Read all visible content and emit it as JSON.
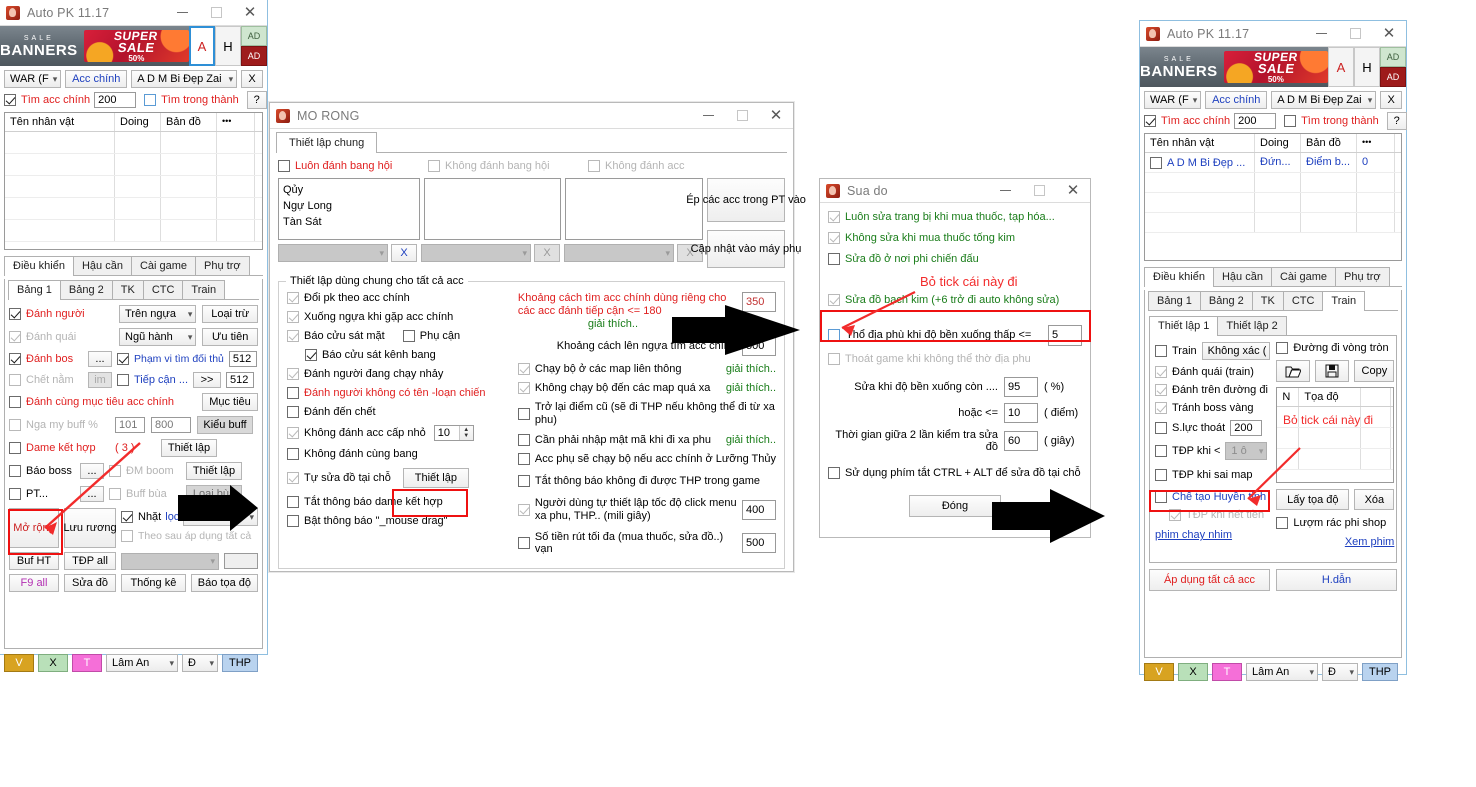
{
  "left_window": {
    "title": "Auto PK 11.17",
    "banner": {
      "sale": "SALE",
      "banners": "BANNERS",
      "super": "SUPER",
      "sale2": "SALE",
      "pct": "50%"
    },
    "a_button": "A",
    "h_button": "H",
    "ad_top": "AD",
    "ad_bottom": "AD",
    "row1": {
      "war_combo": "WAR (F",
      "acc_chinh": "Acc chính",
      "char_combo": "A D M Bi Đẹp Zai",
      "x_button": "X"
    },
    "row2": {
      "tim_acc_chinh": "Tìm acc chính",
      "tim_acc_value": "200",
      "tim_trong_thanh": "Tìm trong thành",
      "help_button": "?"
    },
    "grid_headers": [
      "Tên nhân vật",
      "Doing",
      "Bản đồ",
      "•••"
    ],
    "grid_rows": [],
    "main_tabs": [
      "Điều khiển",
      "Hậu cần",
      "Cài game",
      "Phụ trợ"
    ],
    "sub_tabs": [
      "Bảng 1",
      "Bảng 2",
      "TK",
      "CTC",
      "Train"
    ],
    "panel": {
      "danh_nguoi": "Đánh người",
      "tren_ngua": "Trên ngựa",
      "loai_tru": "Loại trừ",
      "danh_quai": "Đánh quái",
      "ngu_hanh": "Ngũ hành",
      "uu_tien": "Ưu tiên",
      "danh_bos": "Đánh bos",
      "dots": "...",
      "pham_vi": "Phạm vi tìm đối thủ",
      "pham_vi_value": "512",
      "chet_nam": "Chết nằm",
      "im": "im",
      "tiep_can": "Tiếp cận ...",
      "chevron": ">>",
      "tiep_can_value": "512",
      "danh_cung_muc_tieu": "Đánh cùng mục tiêu acc chính",
      "muc_tieu": "Mục tiêu",
      "nga_my_buff": "Nga my buff %",
      "nga_my_v1": "101",
      "nga_my_v2": "800",
      "kieu_buff": "Kiểu buff",
      "dame_ket_hop": "Dame kết hợp",
      "dame_count": "( 3 )",
      "thiet_lap1": "Thiết lập",
      "bao_boss": "Báo boss",
      "dm_boom": "ĐM boom",
      "thiet_lap2": "Thiết lập",
      "pt": "PT...",
      "buff_bua": "Buff bùa",
      "loai_bua": "Loại bùa",
      "mo_rong": "Mở rộng",
      "luu_ruong": "Lưu rương",
      "nhat": "Nhặt",
      "loc": "lọc",
      "tien_v": "Tiền v",
      "theo_sau": "Theo sau áp dụng tất cả",
      "buf_ht": "Buf HT",
      "tdp_all": "TĐP all",
      "f9_all": "F9 all",
      "sua_do": "Sửa đồ",
      "thong_ke": "Thống kê",
      "bao_toa_do": "Báo tọa độ"
    },
    "footer": {
      "v": "V",
      "x": "X",
      "t": "T",
      "lam_an": "Lâm An",
      "d": "Đ",
      "thp": "THP"
    }
  },
  "mo_rong_window": {
    "title": "MO RONG",
    "tab": "Thiết lập chung",
    "top_checks": [
      {
        "label": "Luôn đánh bang hội",
        "checked": false,
        "color": "red"
      },
      {
        "label": "Không đánh bang hội",
        "checked": false,
        "color": "grey"
      },
      {
        "label": "Không đánh acc",
        "checked": false,
        "color": "grey"
      }
    ],
    "list1": [
      "Qủy",
      "Ngự Long",
      "Tàn Sát"
    ],
    "list2": [],
    "list3": [],
    "ep_cac_acc": "Ép các acc trong PT vào",
    "cap_nhat": "Cập nhật vào máy phụ",
    "x1": "X",
    "x2": "X",
    "x3": "X",
    "group_title": "Thiết lập dùng chung cho tất cả acc",
    "left_checks": [
      {
        "label": "Đổi pk theo acc chính",
        "checked": true
      },
      {
        "label": "Xuống ngựa khi gặp acc chính",
        "checked": true
      },
      {
        "label": "Báo cửu sát mặt",
        "checked": true
      },
      {
        "label": "Phụ cận",
        "checked": false
      },
      {
        "label": "Báo cửu sát kênh bang",
        "checked": true,
        "indent": true
      },
      {
        "label": "Đánh người đang chạy nhảy",
        "checked": true
      },
      {
        "label": "Đánh người không có tên -loạn chiến",
        "checked": false,
        "color": "red"
      },
      {
        "label": "Đánh đến chết",
        "checked": false
      },
      {
        "label": "Không đánh acc cấp nhỏ",
        "checked": true,
        "spin": "10"
      },
      {
        "label": "Không đánh cùng bang",
        "checked": false
      },
      {
        "label": "Tự sửa đồ tại chỗ",
        "checked": true,
        "button": "Thiết lập"
      },
      {
        "label": "Tắt thông báo dame kết hợp",
        "checked": false
      },
      {
        "label": "Bật thông báo \"_mouse drag\"",
        "checked": false
      }
    ],
    "right_top_text": "Khoảng cách tìm acc chính dùng riêng cho các acc đánh tiếp cận <= 180",
    "giai_thich": "giải thích..",
    "right_top_value": "350",
    "right_second_text": "Khoảng cách lên ngựa tìm acc chính",
    "right_second_value": "500",
    "right_checks": [
      {
        "label": "Chạy bộ ở các map liên thông",
        "checked": true,
        "link": "giải thích.."
      },
      {
        "label": "Không chạy bộ đến các map quá xa",
        "checked": true,
        "link": "giải thích.."
      },
      {
        "label": "Trở lại điểm cũ (sẽ đi THP nếu không thể đi từ xa phu)",
        "checked": false
      },
      {
        "label": "Cần phải nhập mật mã khi đi xa phu",
        "checked": false,
        "link": "giải thích.."
      },
      {
        "label": "Acc phụ sẽ chạy bộ nếu acc chính ở Lưỡng Thủy",
        "checked": false
      },
      {
        "label": "Tắt thông báo không đi được THP trong game",
        "checked": false
      },
      {
        "label": "Người dùng tự thiết lập tốc độ click menu xa phu, THP.. (mili giây)",
        "checked": true,
        "value": "400"
      },
      {
        "label": "Số tiền rút tối đa (mua thuốc, sửa đồ..) vạn",
        "checked": false,
        "value": "500"
      }
    ]
  },
  "sua_do_window": {
    "title": "Sua do",
    "checks": [
      {
        "label": "Luôn sửa trang bị khi mua thuốc, tạp hóa...",
        "checked": true,
        "color": "green"
      },
      {
        "label": "Không sửa khi mua thuốc tống kim",
        "checked": true,
        "color": "green"
      },
      {
        "label": "Sửa đồ ở nơi phi chiến đấu",
        "checked": false,
        "color": "green"
      },
      {
        "label": "Sửa đồ bạch kim (+6 trở đi auto không sửa)",
        "checked": true,
        "color": "green"
      },
      {
        "label": "Thổ địa phù khi độ bền xuống thấp <=",
        "checked": false,
        "value": "5",
        "highlight": true
      },
      {
        "label": "Thoát game khi không thể thờ địa phu",
        "checked": false,
        "disabled": true
      }
    ],
    "annotation": "Bỏ tick cái này đi",
    "fields": [
      {
        "label": "Sửa khi độ bền xuống còn ....",
        "value": "95",
        "unit": "( %)"
      },
      {
        "label": "hoặc <=",
        "value": "10",
        "unit": "( điểm)"
      },
      {
        "label": "Thời gian giữa 2 lần kiểm tra sửa đồ",
        "value": "60",
        "unit": "( giây)"
      }
    ],
    "hotkey_check": {
      "label": "Sử dụng phím tắt CTRL + ALT để sửa đồ tại chỗ",
      "checked": false
    },
    "close_button": "Đóng"
  },
  "right_window": {
    "title": "Auto PK 11.17",
    "banner": {
      "sale": "SALE",
      "banners": "BANNERS",
      "super": "SUPER",
      "sale2": "SALE",
      "pct": "50%"
    },
    "a_button": "A",
    "h_button": "H",
    "ad_top": "AD",
    "ad_bottom": "AD",
    "row1": {
      "war_combo": "WAR (F",
      "acc_chinh": "Acc chính",
      "char_combo": "A D M Bi Đẹp Zai",
      "x_button": "X"
    },
    "row2": {
      "tim_acc_chinh": "Tìm acc chính",
      "tim_acc_value": "200",
      "tim_trong_thanh": "Tìm trong thành",
      "help_button": "?"
    },
    "grid_headers": [
      "Tên nhân vật",
      "Doing",
      "Bản đồ",
      "•••"
    ],
    "grid_rows": [
      {
        "name": "A D M Bi Đẹp ...",
        "doing": "Đứn...",
        "map": "Điểm b...",
        "num": "0"
      }
    ],
    "main_tabs": [
      "Điều khiển",
      "Hậu cần",
      "Cài game",
      "Phụ trợ"
    ],
    "sub_tabs": [
      "Bảng 1",
      "Bảng 2",
      "TK",
      "CTC",
      "Train"
    ],
    "train_tabs": [
      "Thiết lập 1",
      "Thiết lập 2"
    ],
    "train": {
      "train_check": "Train",
      "khong_xac": "Không xác (",
      "duong_di_vong_tron": "Đường đi vòng tròn",
      "open_icon": "folder-open-icon",
      "save_icon": "save-icon",
      "copy": "Copy",
      "grid_n": "N",
      "grid_toado": "Tọa độ",
      "annotation": "Bỏ tick cái này đi",
      "danh_quai": "Đánh quái (train)",
      "danh_tren_duong": "Đánh trên đường đi",
      "tranh_boss": "Tránh boss vàng",
      "s_luc_thoat": "S.lực thoát",
      "s_luc_value": "200",
      "tdp_khi": "TĐP khi <",
      "tdp_combo": "1 ô",
      "tdp_sai_map": "TĐP khi sai map",
      "che_tao": "Chế tạo Huyền tinh",
      "tdp_het_tien": "TĐP khi hết tiền",
      "phim_chay_nhim": "phim chay nhim",
      "lay_toa_do": "Lấy tọa độ",
      "xoa": "Xóa",
      "luom_rac": "Lượm rác phi shop",
      "xem_phim": "Xem phim",
      "ap_dung": "Áp dụng tất cả acc",
      "h_dan": "H.dẫn"
    },
    "footer": {
      "v": "V",
      "x": "X",
      "t": "T",
      "lam_an": "Lâm An",
      "d": "Đ",
      "thp": "THP"
    }
  },
  "colors": {
    "accent_red": "#e02020",
    "accent_blue": "#1d3fbf",
    "accent_green": "#1a7d1a",
    "annotation_red": "#f22b2b",
    "banner_red": "#c9142e"
  }
}
